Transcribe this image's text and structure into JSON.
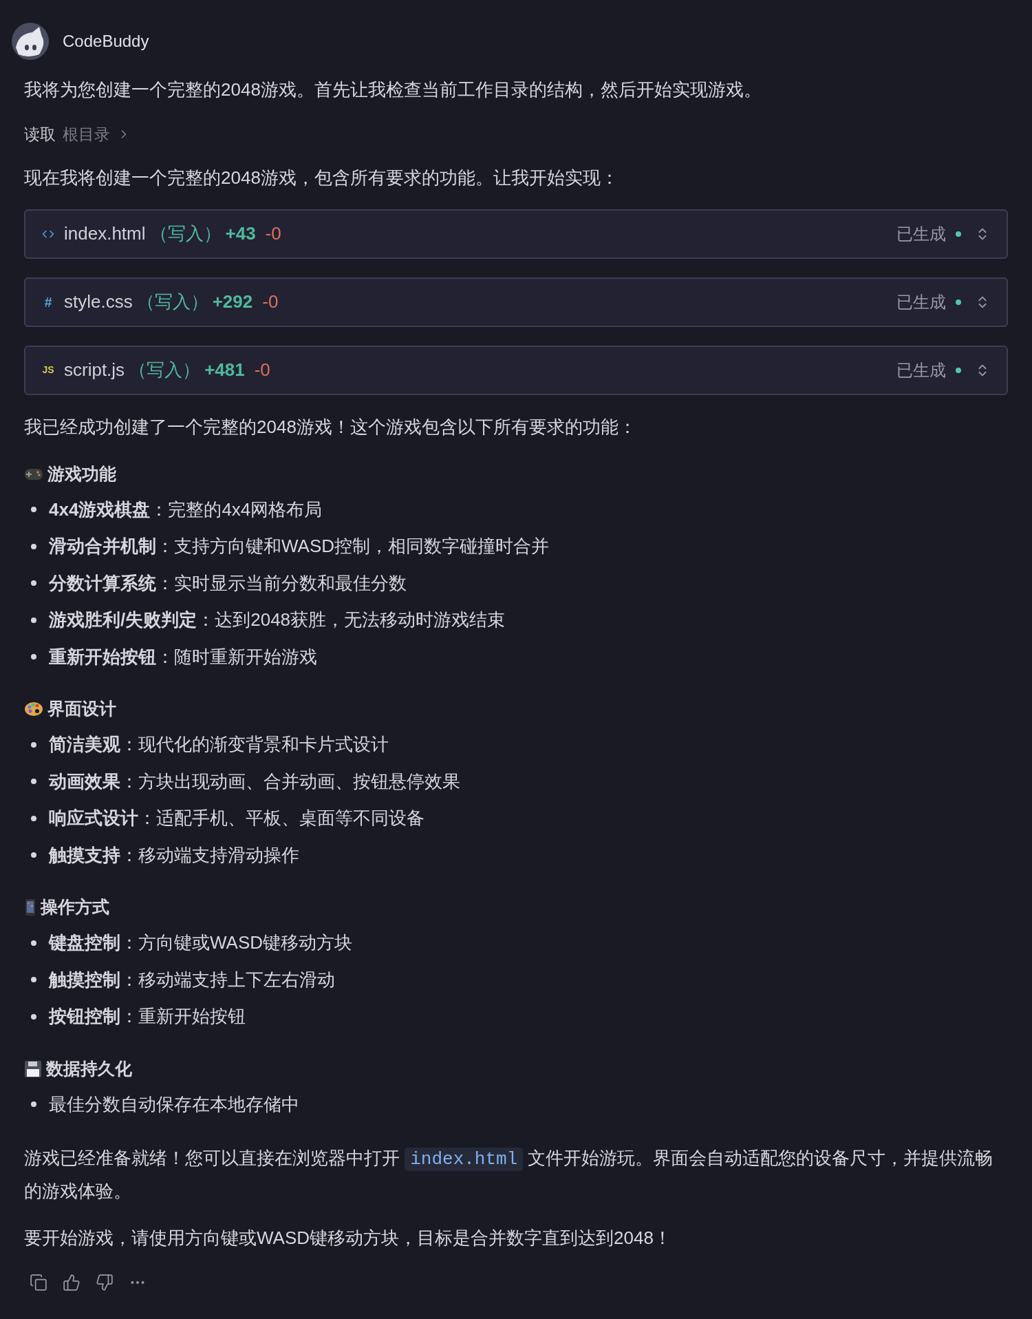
{
  "header": {
    "name": "CodeBuddy"
  },
  "intro": "我将为您创建一个完整的2048游戏。首先让我检查当前工作目录的结构，然后开始实现游戏。",
  "read_step": {
    "action": "读取",
    "target": "根目录"
  },
  "plan": "现在我将创建一个完整的2048游戏，包含所有要求的功能。让我开始实现：",
  "files": [
    {
      "kind": "html",
      "name": "index.html",
      "op": "（写入）",
      "added": "+43",
      "removed": "-0",
      "status": "已生成"
    },
    {
      "kind": "css",
      "badge": "#",
      "name": "style.css",
      "op": "（写入）",
      "added": "+292",
      "removed": "-0",
      "status": "已生成"
    },
    {
      "kind": "js",
      "badge": "JS",
      "name": "script.js",
      "op": "（写入）",
      "added": "+481",
      "removed": "-0",
      "status": "已生成"
    }
  ],
  "summary": "我已经成功创建了一个完整的2048游戏！这个游戏包含以下所有要求的功能：",
  "sections": [
    {
      "kind": "gamepad",
      "title": "游戏功能",
      "items": [
        "**4x4游戏棋盘**：完整的4x4网格布局",
        "**滑动合并机制**：支持方向键和WASD控制，相同数字碰撞时合并",
        "**分数计算系统**：实时显示当前分数和最佳分数",
        "**游戏胜利/失败判定**：达到2048获胜，无法移动时游戏结束",
        "**重新开始按钮**：随时重新开始游戏"
      ]
    },
    {
      "kind": "palette",
      "title": "界面设计",
      "items": [
        "**简洁美观**：现代化的渐变背景和卡片式设计",
        "**动画效果**：方块出现动画、合并动画、按钮悬停效果",
        "**响应式设计**：适配手机、平板、桌面等不同设备",
        "**触摸支持**：移动端支持滑动操作"
      ]
    },
    {
      "kind": "phone",
      "title": "操作方式",
      "items": [
        "**键盘控制**：方向键或WASD键移动方块",
        "**触摸控制**：移动端支持上下左右滑动",
        "**按钮控制**：重新开始按钮"
      ]
    },
    {
      "kind": "floppy",
      "title": "数据持久化",
      "items": [
        "最佳分数自动保存在本地存储中"
      ]
    }
  ],
  "closing": [
    {
      "kind": "text",
      "text": "游戏已经准备就绪！您可以直接在浏览器中打开 "
    },
    {
      "kind": "code",
      "text": "index.html"
    },
    {
      "kind": "text",
      "text": " 文件开始游玩。界面会自动适配您的设备尺寸，并提供流畅的游戏体验。"
    }
  ],
  "final": "要开始游戏，请使用方向键或WASD键移动方块，目标是合并数字直到达到2048！",
  "actions": [
    {
      "kind": "copy"
    },
    {
      "kind": "like"
    },
    {
      "kind": "dislike"
    },
    {
      "kind": "more"
    }
  ]
}
